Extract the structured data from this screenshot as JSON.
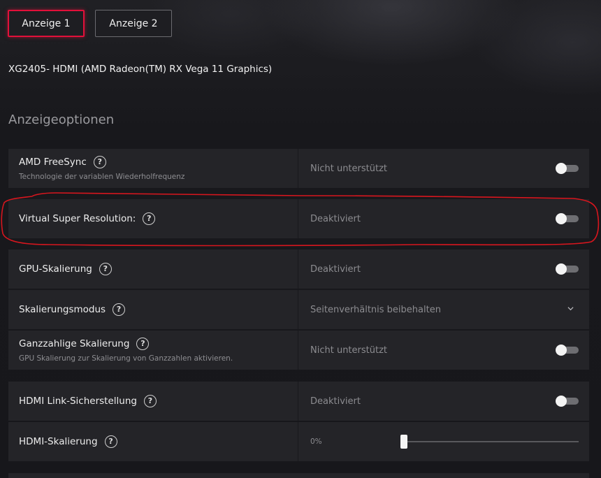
{
  "tabs": [
    {
      "label": "Anzeige 1",
      "active": true
    },
    {
      "label": "Anzeige 2",
      "active": false
    }
  ],
  "device_title": "XG2405- HDMI (AMD Radeon(TM) RX Vega 11 Graphics)",
  "section_title": "Anzeigeoptionen",
  "help_glyph": "?",
  "group1": [
    {
      "label": "AMD FreeSync",
      "sub": "Technologie der variablen Wiederholfrequenz",
      "value": "Nicht unterstützt",
      "control": "toggle",
      "on": false
    },
    {
      "label": "Virtual Super Resolution:",
      "value": "Deaktiviert",
      "control": "toggle",
      "on": false
    },
    {
      "label": "GPU-Skalierung",
      "value": "Deaktiviert",
      "control": "toggle",
      "on": false
    },
    {
      "label": "Skalierungsmodus",
      "value": "Seitenverhältnis beibehalten",
      "control": "dropdown"
    },
    {
      "label": "Ganzzahlige Skalierung",
      "sub": "GPU Skalierung zur Skalierung von Ganzzahlen aktivieren.",
      "value": "Nicht unterstützt",
      "control": "toggle",
      "on": false
    }
  ],
  "group2": [
    {
      "label": "HDMI Link-Sicherstellung",
      "value": "Deaktiviert",
      "control": "toggle",
      "on": false
    },
    {
      "label": "HDMI-Skalierung",
      "value": "0%",
      "control": "slider",
      "level_percent": 0
    }
  ],
  "colors": {
    "accent": "#e2103a",
    "annotation": "#d8161e",
    "row_bg": "#242428",
    "page_bg": "#17171b"
  },
  "icons": {
    "help": "question-circle-icon",
    "dropdown": "chevron-down-icon"
  }
}
